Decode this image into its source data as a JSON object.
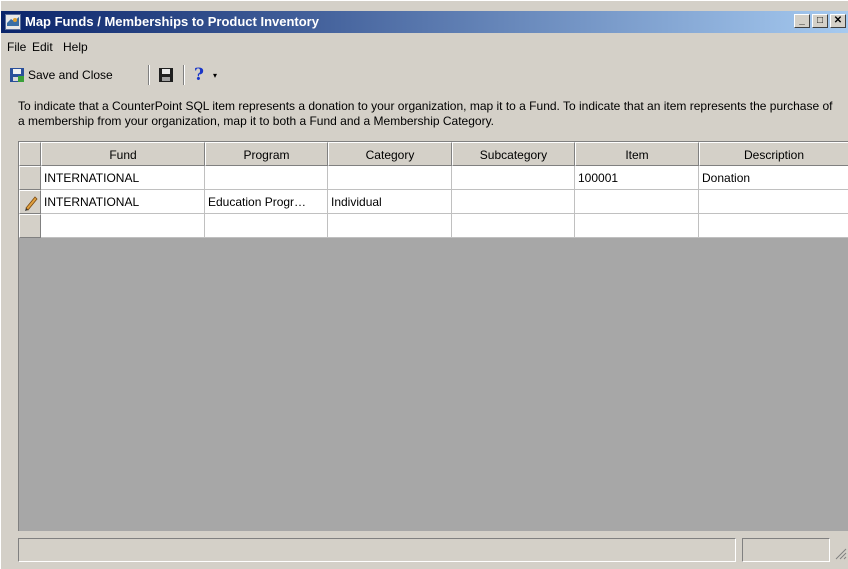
{
  "window": {
    "title": "Map Funds / Memberships to Product Inventory",
    "controls": {
      "minimize": "_",
      "maximize": "□",
      "close": "✕"
    }
  },
  "menu": [
    "File",
    "Edit",
    "Help"
  ],
  "toolbar": {
    "save_close_label": "Save and Close",
    "save_icon": "floppy-disk-icon",
    "help_label": "?",
    "help_dropdown": "▾"
  },
  "instructions": "To indicate that a CounterPoint SQL item represents a donation to your organization, map it to a Fund.  To indicate that an item represents the purchase of a membership from your organization, map it to both a Fund and a Membership Category.",
  "grid": {
    "columns": [
      "Fund",
      "Program",
      "Category",
      "Subcategory",
      "Item",
      "Description"
    ],
    "rows": [
      {
        "marker": "",
        "cells": [
          "INTERNATIONAL",
          "",
          "",
          "",
          "100001",
          "Donation"
        ]
      },
      {
        "marker": "pencil-icon",
        "cells": [
          "INTERNATIONAL",
          "Education Progr…",
          "Individual",
          "",
          "",
          ""
        ]
      },
      {
        "marker": "",
        "cells": [
          "",
          "",
          "",
          "",
          "",
          ""
        ]
      }
    ]
  }
}
